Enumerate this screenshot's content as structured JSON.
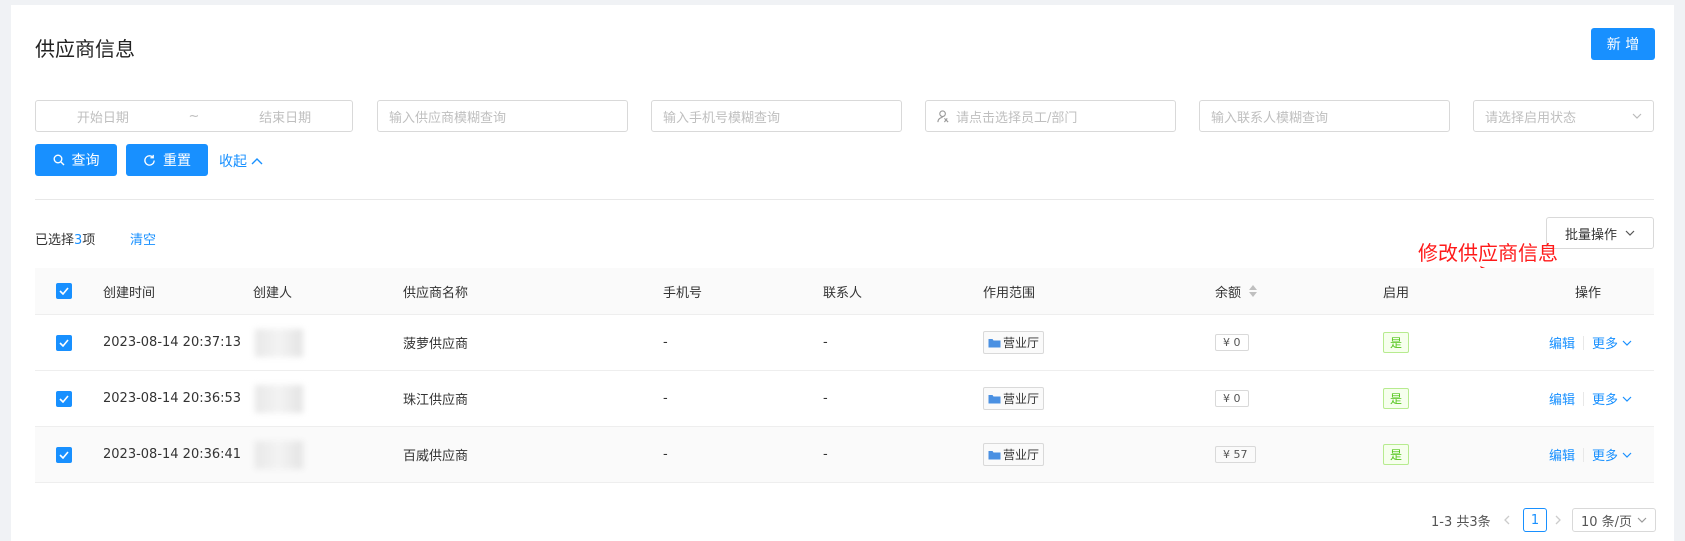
{
  "header": {
    "title": "供应商信息",
    "new_label": "新 增"
  },
  "filters": {
    "start_date_placeholder": "开始日期",
    "range_separator": "~",
    "end_date_placeholder": "结束日期",
    "supplier_placeholder": "输入供应商模糊查询",
    "phone_placeholder": "输入手机号模糊查询",
    "staff_placeholder": "请点击选择员工/部门",
    "contact_placeholder": "输入联系人模糊查询",
    "status_placeholder": "请选择启用状态",
    "query_label": "查询",
    "reset_label": "重置",
    "collapse_label": "收起"
  },
  "selection": {
    "prefix": "已选择",
    "count": "3",
    "suffix": "项",
    "clear_label": "清空"
  },
  "batch_label": "批量操作",
  "annotation": "修改供应商信息",
  "table": {
    "headers": {
      "time": "创建时间",
      "creator": "创建人",
      "name": "供应商名称",
      "phone": "手机号",
      "contact": "联系人",
      "scope": "作用范围",
      "balance": "余额",
      "enabled": "启用",
      "ops": "操作"
    },
    "rows": [
      {
        "time": "2023-08-14 20:37:13",
        "name": "菠萝供应商",
        "phone": "-",
        "contact": "-",
        "scope": "营业厅",
        "balance": "¥ 0",
        "enabled": "是",
        "edit": "编辑",
        "more": "更多"
      },
      {
        "time": "2023-08-14 20:36:53",
        "name": "珠江供应商",
        "phone": "-",
        "contact": "-",
        "scope": "营业厅",
        "balance": "¥ 0",
        "enabled": "是",
        "edit": "编辑",
        "more": "更多"
      },
      {
        "time": "2023-08-14 20:36:41",
        "name": "百威供应商",
        "phone": "-",
        "contact": "-",
        "scope": "营业厅",
        "balance": "¥ 57",
        "enabled": "是",
        "edit": "编辑",
        "more": "更多"
      }
    ]
  },
  "pagination": {
    "total": "1-3 共3条",
    "current": "1",
    "page_size": "10 条/页"
  },
  "colors": {
    "primary": "#1890ff",
    "annotation": "#ff1a1a",
    "success": "#52c41a"
  }
}
